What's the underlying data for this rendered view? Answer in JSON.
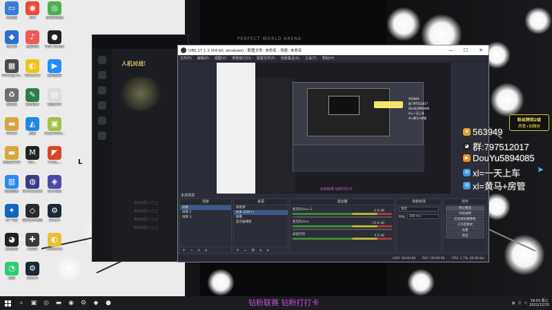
{
  "desktop": {
    "icons": [
      {
        "label": "此电脑",
        "icon": "computer-icon",
        "color": "#3a7bd5",
        "glyph": "▭"
      },
      {
        "label": "360",
        "icon": "browser-360-icon",
        "color": "#e84a3a",
        "glyph": "◉"
      },
      {
        "label": "谷歌浏览器",
        "icon": "chrome-icon",
        "color": "#4caf50",
        "glyph": "◎"
      },
      {
        "label": "鲁大师",
        "icon": "ludashi-icon",
        "color": "#2b6fd6",
        "glyph": "◆"
      },
      {
        "label": "全民K歌",
        "icon": "kge-icon",
        "color": "#ee5a5a",
        "glyph": "♪"
      },
      {
        "label": "OBS Studio",
        "icon": "obs-icon",
        "color": "#222222",
        "glyph": "●"
      },
      {
        "label": "PROC@1%...",
        "icon": "proc-icon",
        "color": "#4a4a4a",
        "glyph": "▦"
      },
      {
        "label": "WeGame",
        "icon": "wegame-icon",
        "color": "#f0c419",
        "glyph": "◐"
      },
      {
        "label": "腾讯视频",
        "icon": "tencent-video-icon",
        "color": "#1f8fff",
        "glyph": "▶"
      },
      {
        "label": "回收站",
        "icon": "recycle-bin-icon",
        "color": "#707070",
        "glyph": "♻"
      },
      {
        "label": "文档助手",
        "icon": "doc-helper-icon",
        "color": "#2e7d4f",
        "glyph": "✎"
      },
      {
        "label": "新建文本",
        "icon": "text-file-icon",
        "color": "#dddddd",
        "glyph": "▤"
      },
      {
        "label": "Win10",
        "icon": "win10-folder-icon",
        "color": "#d8a640",
        "glyph": "▬"
      },
      {
        "label": "迅雷",
        "icon": "xunlei-icon",
        "color": "#1e88e5",
        "glyph": "◭"
      },
      {
        "label": "EasyVideo...",
        "icon": "easyvideo-icon",
        "color": "#a0c04a",
        "glyph": "▣"
      },
      {
        "label": "新建文件夹",
        "icon": "folder-icon",
        "color": "#d8a640",
        "glyph": "▬"
      },
      {
        "label": "MA...",
        "icon": "ma-icon",
        "color": "#222222",
        "glyph": "M"
      },
      {
        "label": "PIXEL...",
        "icon": "pixel-icon",
        "color": "#d8462a",
        "glyph": "◤"
      },
      {
        "label": "控制面板",
        "icon": "control-panel-icon",
        "color": "#2d89ef",
        "glyph": "▥"
      },
      {
        "label": "GameSpeed",
        "icon": "gamespeed-icon",
        "color": "#3a3a8a",
        "glyph": "◍"
      },
      {
        "label": "安心导航",
        "icon": "anxin-icon",
        "color": "#4a4aaa",
        "glyph": "◈"
      },
      {
        "label": "BT下载",
        "icon": "bt-icon",
        "color": "#1565c0",
        "glyph": "✦"
      },
      {
        "label": "完美世界竞技",
        "icon": "perfect-world-icon",
        "color": "#2a2a2a",
        "glyph": "◇"
      },
      {
        "label": "Steam",
        "icon": "steam-icon-2",
        "color": "#1b2838",
        "glyph": "⚙"
      },
      {
        "label": "腾讯QQ",
        "icon": "qq-icon",
        "color": "#222222",
        "glyph": "◕"
      },
      {
        "label": "CSGO",
        "icon": "csgo-icon",
        "color": "#3a3a3a",
        "glyph": "✚"
      },
      {
        "label": "WeGame",
        "icon": "wegame-icon-2",
        "color": "#e8c030",
        "glyph": "◐"
      },
      {
        "label": "微信",
        "icon": "wechat-icon",
        "color": "#2ecc71",
        "glyph": "◔"
      },
      {
        "label": "Steam",
        "icon": "steam-icon",
        "color": "#1b2838",
        "glyph": "⚙"
      }
    ],
    "cursor_text": "L"
  },
  "game": {
    "brand": "人机对战!",
    "arena_title": "PERFECT WORLD ARENA",
    "ghost_lines": [
      "高级匹配 | 已上",
      "高级匹配 | 已上",
      "高级匹配 | 已上",
      "高级匹配 | 已上"
    ]
  },
  "obs": {
    "title": "OBS 27.1.3 (64-bit, windows) - 配置文件: 未命名 - 场景: 未命名",
    "window_controls": [
      "—",
      "☐",
      "✕"
    ],
    "menu": [
      "文件(F)",
      "编辑(E)",
      "视图(V)",
      "停靠窗口(D)",
      "配置文件(P)",
      "场景集合(S)",
      "工具(T)",
      "帮助(H)"
    ],
    "scene_label": "未选择源",
    "preview_tabs": "属性   滤镜",
    "scenes": {
      "title": "场景",
      "items": [
        "场景",
        "场景 2",
        "场景 3"
      ]
    },
    "sources": {
      "title": "来源",
      "items": [
        "嵌套源",
        "文本 (GDI+)",
        "图像",
        "显示器捕获"
      ]
    },
    "mixer": {
      "title": "混音器",
      "channels": [
        {
          "name": "麦克风/Aux 2",
          "db": "-2.6 dB"
        },
        {
          "name": "麦克风/Aux",
          "db": "-15.8 dB"
        },
        {
          "name": "桌面音频",
          "db": "0.0 dB"
        }
      ]
    },
    "transitions": {
      "title": "场景转场",
      "type": "渐变",
      "duration_label": "时长",
      "duration": "300 ms"
    },
    "controls": {
      "title": "控件",
      "buttons": [
        "停止推流",
        "开始录制",
        "启动虚拟摄像机",
        "工作室模式",
        "设置",
        "退出"
      ]
    },
    "status": {
      "live": "LIVE: 00:00:00",
      "rec": "REC: 00:00:00",
      "cpu": "CPU: 1.7%, 60.00 fps"
    },
    "nested": {
      "overlay_lines": [
        "563949",
        "群:797512017",
        "DouYu5894086",
        "xl=一天上车",
        "xl=黄马+房管"
      ],
      "bottom_text": "钻粉联赛 钻粉打打卡"
    }
  },
  "overlay": {
    "fan_banner_line1": "粉丝牌到2级",
    "fan_banner_line2": "房管+加微信",
    "rows": [
      {
        "icon": "coin-icon",
        "color": "#e0a030",
        "glyph": "¥",
        "text": "563949"
      },
      {
        "icon": "penguin-icon",
        "color": "#222222",
        "glyph": "◕",
        "text": "群:797512017"
      },
      {
        "icon": "douyu-icon",
        "color": "#f08a1e",
        "glyph": "▶",
        "text": "DouYu5894085"
      },
      {
        "icon": "chat-icon",
        "color": "#3a9ae0",
        "glyph": "✉",
        "text": "xl=一天上车"
      },
      {
        "icon": "chat-icon-2",
        "color": "#3a9ae0",
        "glyph": "✉",
        "text": "xl=黄马+房管"
      }
    ],
    "bottom_caption": "钻粉联赛 钻粉打打卡"
  },
  "taskbar": {
    "apps": [
      {
        "icon": "search-icon",
        "glyph": "⌕"
      },
      {
        "icon": "task-view-icon",
        "glyph": "▣"
      },
      {
        "icon": "chrome-taskbar-icon",
        "glyph": "◎"
      },
      {
        "icon": "explorer-icon",
        "glyph": "▬"
      },
      {
        "icon": "browser-taskbar-icon",
        "glyph": "◉"
      },
      {
        "icon": "steam-taskbar-icon",
        "glyph": "⚙"
      },
      {
        "icon": "game-taskbar-icon",
        "glyph": "◆"
      },
      {
        "icon": "obs-taskbar-icon",
        "glyph": "●"
      }
    ],
    "tray_text": "英",
    "time": "19:03 周三",
    "date": "2021/12/15"
  }
}
